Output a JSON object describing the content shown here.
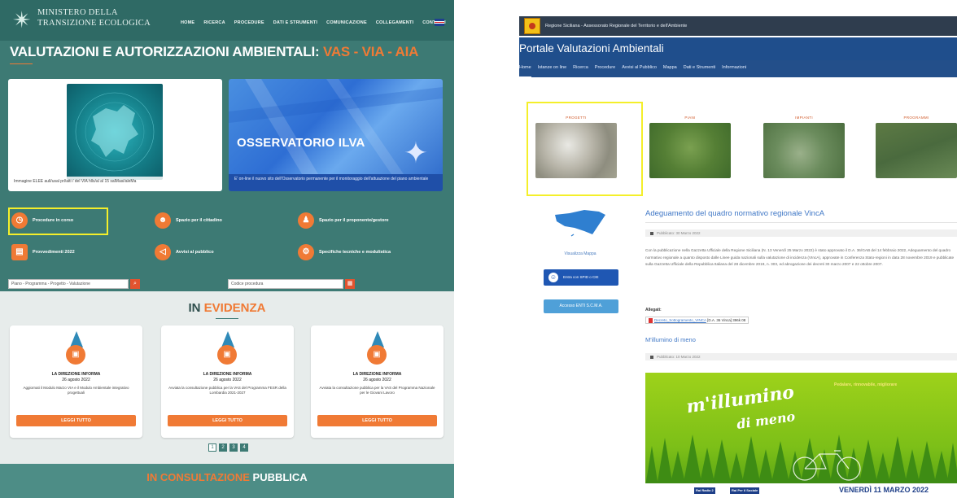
{
  "left": {
    "logo": {
      "line1": "MINISTERO DELLA",
      "line2": "TRANSIZIONE ECOLOGICA",
      "icon": "star-emblem-icon"
    },
    "nav": [
      "HOME",
      "RICERCA",
      "PROCEDURE",
      "DATI E STRUMENTI",
      "COMUNICAZIONE",
      "COLLEGAMENTI",
      "CONTATTI"
    ],
    "lang_icon": "uk-flag-icon",
    "title_main": "VALUTAZIONI E AUTORIZZAZIONI AMBIENTALI: ",
    "title_accent": "VAS - VIA - AIA",
    "card1_caption": "Immagine ELEE aull/usal prl/aiti / del VIA hlls/al al 15 salMasi/aleMa",
    "card2_title": "OSSERVATORIO ILVA",
    "card2_caption": "E' on-line il nuovo sito dell'Osservatorio permanente per il monitoraggio dell'attuazione del piano ambientale",
    "quick_links": [
      {
        "label": "Procedure in corso",
        "icon": "clock-icon"
      },
      {
        "label": "Spazio per il cittadino",
        "icon": "people-icon"
      },
      {
        "label": "Spazio per il proponente/gestore",
        "icon": "worker-icon"
      },
      {
        "label": "Provvedimenti 2022",
        "icon": "document-icon"
      },
      {
        "label": "Avvisi al pubblico",
        "icon": "megaphone-icon"
      },
      {
        "label": "Specifiche tecniche e modulistica",
        "icon": "gears-icon"
      }
    ],
    "search1_placeholder": "Piano - Programma - Progetto - Valutazione",
    "search2_placeholder": "Codice procedura",
    "search_icon": "search-icon",
    "calendar_icon": "calendar-icon",
    "evidenza_main": "IN ",
    "evidenza_accent": "EVIDENZA",
    "news": [
      {
        "title": "LA DIREZIONE INFORMA",
        "date": "26 agosto 2022",
        "text": "Aggiornati il Modulo Marzo VIA e il Modulo Ambientale integrativo progettuali",
        "button": "LEGGI TUTTO"
      },
      {
        "title": "LA DIREZIONE INFORMA",
        "date": "26 agosto 2022",
        "text": "Avviata la consultazione pubblica per la VAS del Programma FESR della Lombardia 2021-2027",
        "button": "LEGGI TUTTO"
      },
      {
        "title": "LA DIREZIONE INFORMA",
        "date": "26 agosto 2022",
        "text": "Avviata la consultazione pubblica per la VAS del Programma Nazionale per le Giovani Lavoro",
        "button": "LEGGI TUTTO"
      }
    ],
    "pager": [
      "1",
      "2",
      "3",
      "4"
    ],
    "consult_accent": "IN CONSULTAZIONE ",
    "consult_main": "PUBBLICA"
  },
  "right": {
    "institution": "Regione Siciliana - Assessorato Regionale del Territorio e dell'Ambiente",
    "portal_title": "Portale Valutazioni Ambientali",
    "nav": [
      "Home",
      "Istanze on line",
      "Ricerca",
      "Procedure",
      "Avvisi al Pubblico",
      "Mappa",
      "Dati e Strumenti",
      "Informazioni"
    ],
    "categories": [
      "PROGETTI",
      "PIANI",
      "IMPIANTI",
      "PROGRAMMI"
    ],
    "map_label": "Visualizza Mappa",
    "spid_label": "Entra con SPID o CIE",
    "access_label": "Accesso ENTI S.C.M.A.",
    "article1_title": "Adeguamento del quadro normativo regionale VincA",
    "article1_meta": "Pubblicato: 30 Marzo 2022",
    "article1_body": "Con la pubblicazione nella Gazzetta Ufficiale della Regione Siciliana (N. 13 Venerdì 25 Marzo 2022) è stato approvato il D.A. 36/GAB del 14 febbraio 2022, Adeguamento del quadro normativo regionale a quanto disposto dalle Linee guida nazionali sulla valutazione di incidenza (VIncA), approvate in Conferenza Stato-regioni in data 28 novembre 2019 e pubblicate sulla Gazzetta Ufficiale della Repubblica Italiana del 28 dicembre 2019, n. 303, ed abrogazione dei decreti 30 marzo 2007 e 22 ottobre 2007.",
    "allegati_label": "Allegati:",
    "attachment_name": "Decreto_Sottogramento_VINCA",
    "attachment_meta": "[D.A. 36 Vinca]  396k 08",
    "article2_title": "M'illumino di meno",
    "article2_meta": "Pubblicato: 10 Marzo 2022",
    "banner_tag": "Pedalare, rinnovabile, migliorare",
    "banner_line1": "m'illumino",
    "banner_line2": "di meno",
    "rai1": "Rai Radio 2",
    "rai2": "Rai Per il Sociale",
    "banner_date": "VENERDÌ 11 MARZO 2022"
  }
}
